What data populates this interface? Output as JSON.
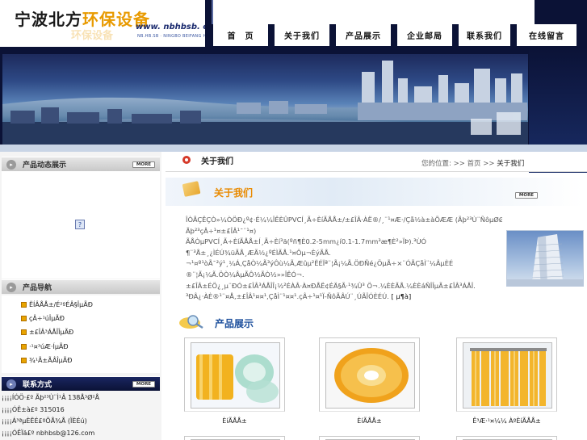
{
  "header": {
    "logo_prefix": "宁波北方",
    "logo_highlight": "环保设备",
    "logo_shadow_text": "环保设备",
    "logo_url": "www. nbhbsb. cn",
    "logo_url_sub": "NB.HB.SB · NINGBO BEIFANG HUANBAO"
  },
  "nav": {
    "items": [
      {
        "label": "首　页"
      },
      {
        "label": "关于我们"
      },
      {
        "label": "产品展示"
      },
      {
        "label": "企业邮局"
      },
      {
        "label": "联系我们"
      },
      {
        "label": "在线留言"
      }
    ]
  },
  "left": {
    "news_title": "产品动态展示",
    "more_label": "MORE",
    "broken_image_glyph": "?",
    "nav_title": "产品导航",
    "nav_links": [
      "ËÍÂÅÅ±/É²ºÉÂ§ÎµÃÐ",
      "çÂ÷¹úÎµÃÐ",
      "±£ÎÂ³ÁÅÎÎµÃÐ",
      "·¹¤³úÆ·ÍµÃÐ",
      "¾¹Ã±ÃÂÎµÃÐ"
    ],
    "contact_title": "联系方式",
    "contact_lines": [
      "¡¡¡¡ÍÓÖ·£º Ãþ²³Ù¨Ì¹Â 138Å³Ø²Å",
      "¡¡¡¡ÓÊ±à£º 315016",
      "¡¡¡¡Á³ªµÈËÉ£ºÕÅ¾Å (ÏÈÉú)",
      "¡¡¡¡ÓÊÏä£º nbhbsb@126.com"
    ]
  },
  "main": {
    "section_title": "关于我们",
    "breadcrumb_label": "您的位置:",
    "breadcrumb_sep": ">>",
    "breadcrumb_home": "首页",
    "breadcrumb_current": "关于我们",
    "about_title": "关于我们",
    "about_more": "MORE",
    "about_lines": [
      "ÎÒÃÇÊÇÒ»¼ÒÖÐ¿º¢·É¼¼ÎÊÈÛPVCÍ¸Ã÷ÈíÃÅÅ±/±£ÎÂ·ÀË®/¸¨¹¤Æ·/Çå½à±àÕÆÆ (Ãþ²³Ù¨ÑôµØØ²ÆÆ±£",
      "Ãþ²³çÂ÷¹¤±£ÎÂ¹¯¨¹¤)",
      "ÃÅÒµPVCÍ¸Ã÷ÈíÃÅÅ±Í¸Ã÷Èí³ä(ºñ¶È0.2-5mm¿í0.1-1.7mm³æ¶È²»ÏÞ).³ÙÓ",
      "¶¨³Å±¸¿ÌÉÚ¾üÃÅ¸ÆÃ½¿ºÉÌÃÅ.¹¤Ôµ¬ÈýÃÅ.",
      "¬¹¤º¹òÃ¯²ý¹¸¼Á,ÇåÒ¼Ã³ýÔù¼Ã,Æûµ²ËÉÏª¨¦Ã¡¼Ã.ÖÐÑé¿ÖµÃ÷×¨ÓÃÇåÌ¨¼ÂµÈÉ",
      "®¨¦Ã¡¼Ã.ÖÒ¼ÂµÃÔ½ÃÒ½»»ÎÊÓ¬.",
      "±£ÎÂ±ÉÖ¿¸µ¨ÐÓ±£ÎÂ³ÁÅÎÎ¡½²ÉÀÂ·À¤ÐÅË¢ÉÄ§Ã·¹¾Û³ Ö¬.¼ÈÈÃÅ.¼ÈÈáÑÎÎµÃ±£ÎÂ³ÁÅÎ.",
      "³ÐÂ¿·ÀÈ®¹¨¤Å,±£ÎÂ¹¤¤¹,ÇåÌ¨¹¤¤¹.çÂ÷¹¤¹Ï-ÑôÃÂÚ¨¸ÚÃÎÓÈÉÚ."
    ],
    "about_link": "[ µ¶à]",
    "products_title": "产品展示",
    "products": [
      {
        "caption": "ÈíÃÅÅ±"
      },
      {
        "caption": "ÈíÃÅÅ±"
      },
      {
        "caption": "Ê³Æ·¹¤¼¼ ÀºÈíÃÅÅ±"
      }
    ]
  },
  "colors": {
    "navy": "#0b1236",
    "accent_orange": "#e98a00",
    "product_blue": "#1c4f9c"
  }
}
